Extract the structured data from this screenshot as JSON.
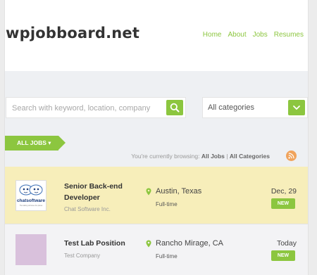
{
  "brand": "wpjobboard.net",
  "nav": [
    "Home",
    "About",
    "Jobs",
    "Resumes"
  ],
  "search": {
    "placeholder": "Search with keyword, location, company"
  },
  "category": {
    "selected": "All categories"
  },
  "filter_tab": "ALL JOBS ▾",
  "browsing": {
    "prefix": "You're currently browsing:",
    "jobs": "All Jobs",
    "separator": " | ",
    "categories": "All Categories"
  },
  "jobs": [
    {
      "title": "Senior Back-end Developer",
      "company": "Chat Software Inc.",
      "location": "Austin, Texas",
      "type": "Full-time",
      "date": "Dec, 29",
      "badge": "NEW",
      "logo_text": "chatsoftware",
      "logo_subtext": "The talking will save the planet"
    },
    {
      "title": "Test Lab Position",
      "company": "Test Company",
      "location": "Rancho Mirage, CA",
      "type": "Full-time",
      "date": "Today",
      "badge": "NEW"
    }
  ],
  "colors": {
    "accent": "#8cc63f",
    "featured_bg": "#f7eeba",
    "rss": "#f0a35c"
  }
}
